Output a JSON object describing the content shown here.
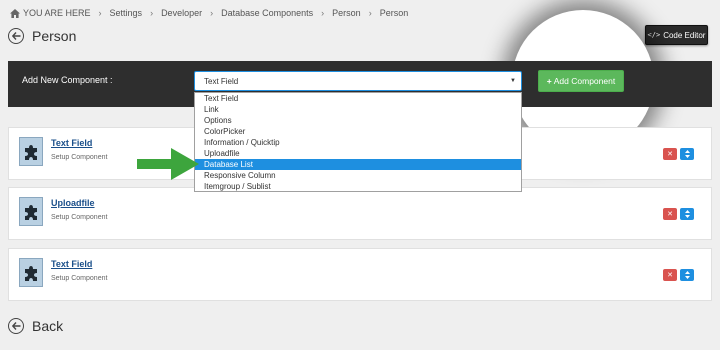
{
  "breadcrumb": {
    "home_label": "YOU ARE HERE",
    "items": [
      "Settings",
      "Developer",
      "Database Components",
      "Person",
      "Person"
    ]
  },
  "page_title": "Person",
  "toolbar": {
    "code_editor_label": "Code Editor"
  },
  "add_bar": {
    "label": "Add New Component :",
    "selected_value": "Text Field",
    "add_button_label": "Add Component"
  },
  "dropdown": {
    "options": [
      "Text Field",
      "Link",
      "Options",
      "ColorPicker",
      "Information / Quicktip",
      "Uploadfile",
      "Database List",
      "Responsive Column",
      "Itemgroup / Sublist"
    ],
    "highlighted": "Database List"
  },
  "components": [
    {
      "name": "Text Field",
      "subtitle": "Setup Component"
    },
    {
      "name": "Uploadfile",
      "subtitle": "Setup Component"
    },
    {
      "name": "Text Field",
      "subtitle": "Setup Component"
    }
  ],
  "back_label": "Back",
  "colors": {
    "accent_blue": "#1e8fe0",
    "add_green": "#5cb85c",
    "delete_red": "#d9534f",
    "bar_dark": "#2e2e2e",
    "arrow_green": "#3da53d"
  },
  "icons": [
    "home-icon",
    "back-arrow-icon",
    "code-icon",
    "plus-icon",
    "caret-down-icon",
    "puzzle-icon",
    "close-icon",
    "sort-icon"
  ]
}
